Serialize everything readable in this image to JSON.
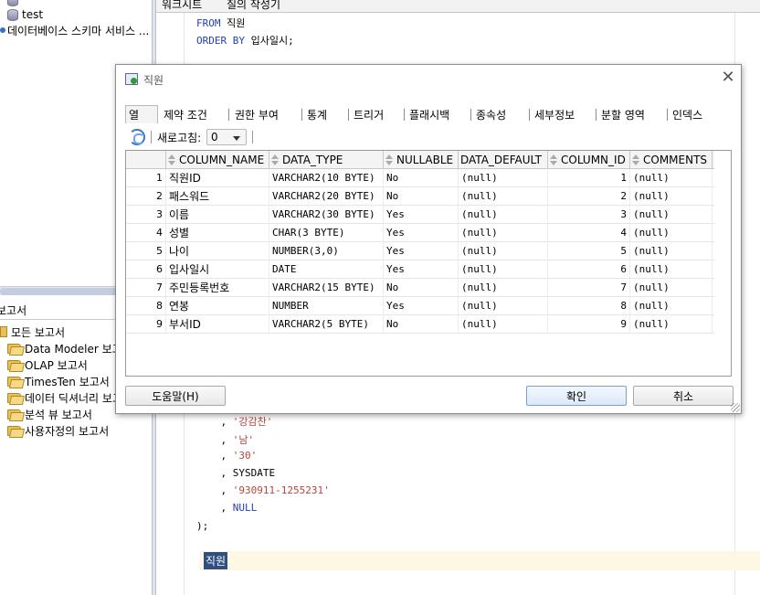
{
  "navigator": {
    "items": [
      {
        "label": "test",
        "icon": "database-icon"
      },
      {
        "label": "데이터베이스 스키마 서비스 ...",
        "icon": "schema-service-icon"
      }
    ],
    "reports_header": "보고서",
    "report_items": [
      {
        "label": "모든 보고서"
      },
      {
        "label": "Data Modeler 보고서"
      },
      {
        "label": "OLAP 보고서"
      },
      {
        "label": "TimesTen 보고서"
      },
      {
        "label": "데이터 딕셔너리 보고서"
      },
      {
        "label": "분석 뷰 보고서"
      },
      {
        "label": "사용자정의 보고서"
      }
    ]
  },
  "editor": {
    "tabs": [
      "워크시트",
      "질의 작성기"
    ],
    "code_top": [
      {
        "kw": "FROM",
        "rest": " 직원",
        "indent": "  "
      },
      {
        "kw": "ORDER BY",
        "rest": " 입사일시;",
        "indent": ""
      }
    ],
    "code_bottom": [
      {
        "prefix": "    , ",
        "value": "'강감찬'",
        "type": "str"
      },
      {
        "prefix": "    , ",
        "value": "'남'",
        "type": "str"
      },
      {
        "prefix": "    , ",
        "value": "'30'",
        "type": "str"
      },
      {
        "prefix": "    , ",
        "value": "SYSDATE",
        "type": "plain"
      },
      {
        "prefix": "    , ",
        "value": "'930911-1255231'",
        "type": "str"
      },
      {
        "prefix": "    , ",
        "value": "NULL",
        "type": "kw"
      },
      {
        "prefix": "",
        "value": ");",
        "type": "plain"
      }
    ],
    "selected_word": "직원"
  },
  "dialog": {
    "title": "직원",
    "close_glyph": "✕",
    "tabs": [
      "열",
      "제약 조건",
      "권한 부여",
      "통계",
      "트리거",
      "플래시백",
      "종속성",
      "세부정보",
      "분할 영역",
      "인덱스"
    ],
    "active_tab": "열",
    "toolbar": {
      "refresh_label": "새로고침:",
      "refresh_value": "0"
    },
    "columns": [
      "COLUMN_NAME",
      "DATA_TYPE",
      "NULLABLE",
      "DATA_DEFAULT",
      "COLUMN_ID",
      "COMMENTS"
    ],
    "rows": [
      {
        "n": "1",
        "name": "직원ID",
        "type": "VARCHAR2(10 BYTE)",
        "nullable": "No",
        "default": "(null)",
        "id": "1",
        "comments": "(null)"
      },
      {
        "n": "2",
        "name": "패스워드",
        "type": "VARCHAR2(20 BYTE)",
        "nullable": "No",
        "default": "(null)",
        "id": "2",
        "comments": "(null)"
      },
      {
        "n": "3",
        "name": "이름",
        "type": "VARCHAR2(30 BYTE)",
        "nullable": "Yes",
        "default": "(null)",
        "id": "3",
        "comments": "(null)"
      },
      {
        "n": "4",
        "name": "성별",
        "type": "CHAR(3 BYTE)",
        "nullable": "Yes",
        "default": "(null)",
        "id": "4",
        "comments": "(null)"
      },
      {
        "n": "5",
        "name": "나이",
        "type": "NUMBER(3,0)",
        "nullable": "Yes",
        "default": "(null)",
        "id": "5",
        "comments": "(null)"
      },
      {
        "n": "6",
        "name": "입사일시",
        "type": "DATE",
        "nullable": "Yes",
        "default": "(null)",
        "id": "6",
        "comments": "(null)"
      },
      {
        "n": "7",
        "name": "주민등록번호",
        "type": "VARCHAR2(15 BYTE)",
        "nullable": "No",
        "default": "(null)",
        "id": "7",
        "comments": "(null)"
      },
      {
        "n": "8",
        "name": "연봉",
        "type": "NUMBER",
        "nullable": "Yes",
        "default": "(null)",
        "id": "8",
        "comments": "(null)"
      },
      {
        "n": "9",
        "name": "부서ID",
        "type": "VARCHAR2(5 BYTE)",
        "nullable": "No",
        "default": "(null)",
        "id": "9",
        "comments": "(null)"
      }
    ],
    "buttons": {
      "help": "도움말(H)",
      "ok": "확인",
      "cancel": "취소"
    }
  },
  "colors": {
    "keyword": "#1f3fb8",
    "string": "#b4463c",
    "selection": "#2e4f80",
    "current_line": "#fdf7e4"
  }
}
